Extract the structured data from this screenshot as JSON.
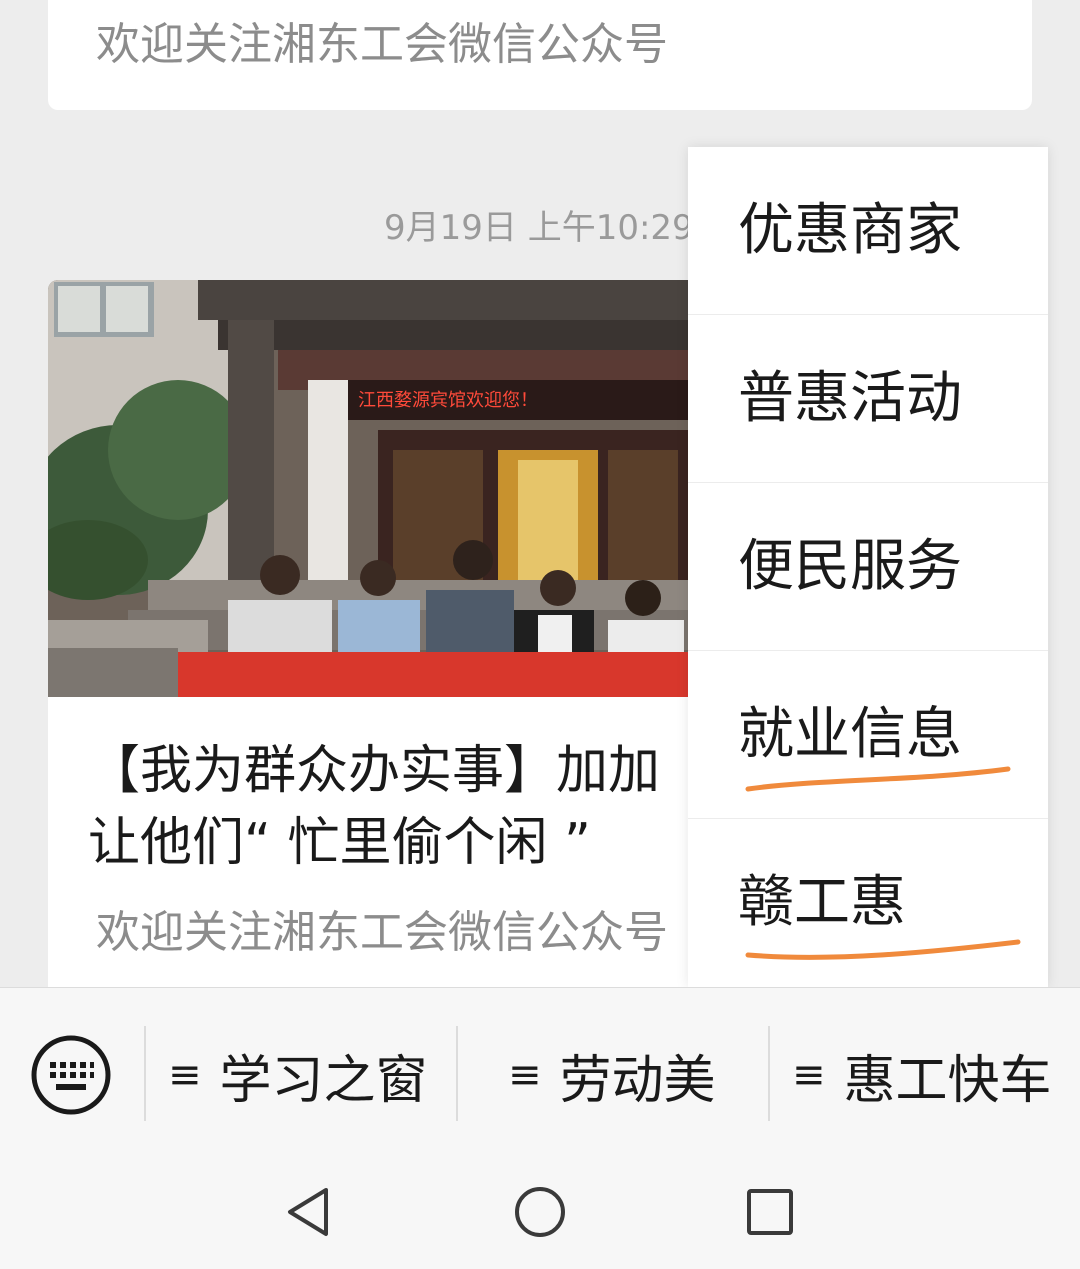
{
  "previous_article": {
    "source": "欢迎关注湘东工会微信公众号"
  },
  "timestamp": "9月19日 上午10:29",
  "article": {
    "title": "【我为群众办实事】加加…让他们“ 忙里偷个闲 ”",
    "title_line1": "【我为群众办实事】加加",
    "title_line2": "让他们“ 忙里偷个闲 ”",
    "source": "欢迎关注湘东工会微信公众号",
    "cover_banner_text": "江西婺源宾馆欢迎您！"
  },
  "submenu": {
    "items": [
      {
        "label": "优惠商家",
        "underlined": false
      },
      {
        "label": "普惠活动",
        "underlined": false
      },
      {
        "label": "便民服务",
        "underlined": false
      },
      {
        "label": "就业信息",
        "underlined": true
      },
      {
        "label": "赣工惠",
        "underlined": true
      }
    ],
    "underline_color": "#f08a3c"
  },
  "menubar": {
    "keyboard_icon": "keyboard-icon",
    "tabs": [
      {
        "icon": "≡",
        "label": "学习之窗"
      },
      {
        "icon": "≡",
        "label": "劳动美"
      },
      {
        "icon": "≡",
        "label": "惠工快车"
      }
    ]
  },
  "navbar": {
    "buttons": [
      "back-icon",
      "home-icon",
      "recents-icon"
    ]
  }
}
